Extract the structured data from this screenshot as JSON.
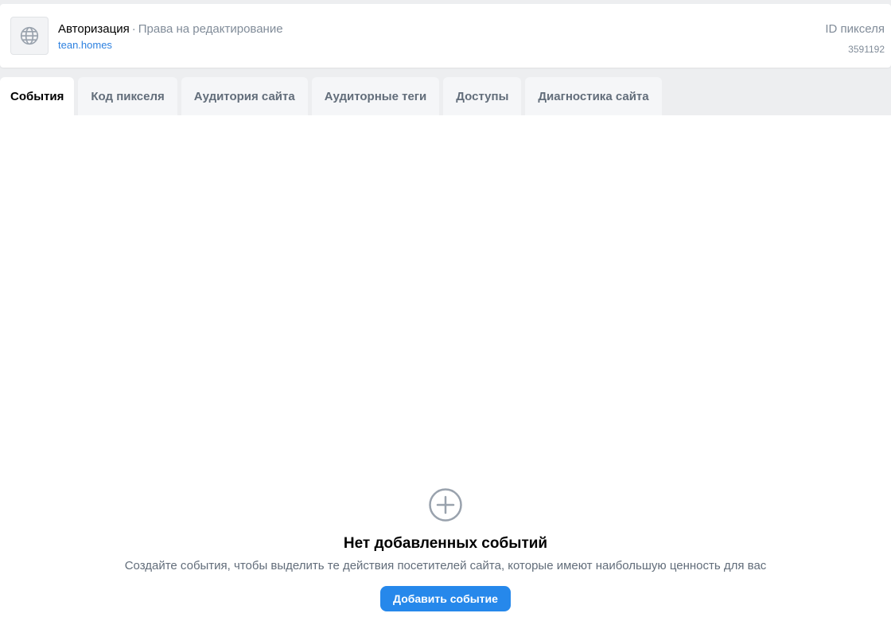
{
  "header": {
    "title": "Авторизация",
    "separator": "·",
    "rights": "Права на редактирование",
    "domain": "tean.homes",
    "site_icon": "globe-icon",
    "pixel_id_label": "ID пикселя",
    "pixel_id_value": "3591192"
  },
  "tabs": [
    {
      "label": "События",
      "active": true
    },
    {
      "label": "Код пикселя",
      "active": false
    },
    {
      "label": "Аудитория сайта",
      "active": false
    },
    {
      "label": "Аудиторные теги",
      "active": false
    },
    {
      "label": "Доступы",
      "active": false
    },
    {
      "label": "Диагностика сайта",
      "active": false
    }
  ],
  "empty_state": {
    "icon": "plus-circle-icon",
    "title": "Нет добавленных событий",
    "description": "Создайте события, чтобы выделить те действия посетителей сайта, которые имеют наибольшую ценность для вас",
    "button_label": "Добавить событие"
  },
  "colors": {
    "accent": "#2688eb",
    "link": "#2d81e0",
    "muted_text": "#818c99",
    "background": "#edeef0"
  }
}
